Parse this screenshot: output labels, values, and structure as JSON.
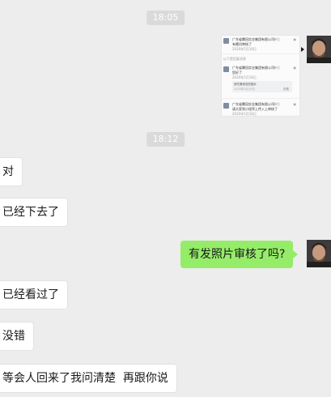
{
  "timestamps": [
    "18:05",
    "18:12"
  ],
  "screenshot": {
    "post1": {
      "name": "广东省腾冠实业集团有限公司",
      "tag": "单位",
      "text": "有需问审核了",
      "time": "2020年5月18日"
    },
    "divider": "以下是回复消息",
    "post2": {
      "name": "广东省腾冠实业集团有限公司",
      "tag": "单位",
      "text": "您好了",
      "time": "2020年5月18日",
      "quote_text": "请先看我发的图片",
      "quote_meta": "2020年5月18日",
      "quote_action": "查看"
    },
    "post3": {
      "name": "广东省腾冠实业集团有限公司",
      "tag": "单位",
      "text": "请大家到小程序上传入上审核了",
      "time": "2020年5月18日"
    }
  },
  "messages": [
    {
      "side": "left",
      "text": "对"
    },
    {
      "side": "left",
      "text": "已经下去了"
    },
    {
      "side": "right",
      "text": "有发照片审核了吗?"
    },
    {
      "side": "left",
      "text": "已经看过了"
    },
    {
      "side": "left",
      "text": "没错"
    },
    {
      "side": "left",
      "text": "等会人回来了我问清楚  再跟你说"
    }
  ],
  "colors": {
    "background": "#ededed",
    "sent_bubble": "#95ec69",
    "received_bubble": "#ffffff",
    "timestamp_bg": "#dadada"
  },
  "icons": [
    "user-avatar",
    "pointer-arrow-icon"
  ]
}
